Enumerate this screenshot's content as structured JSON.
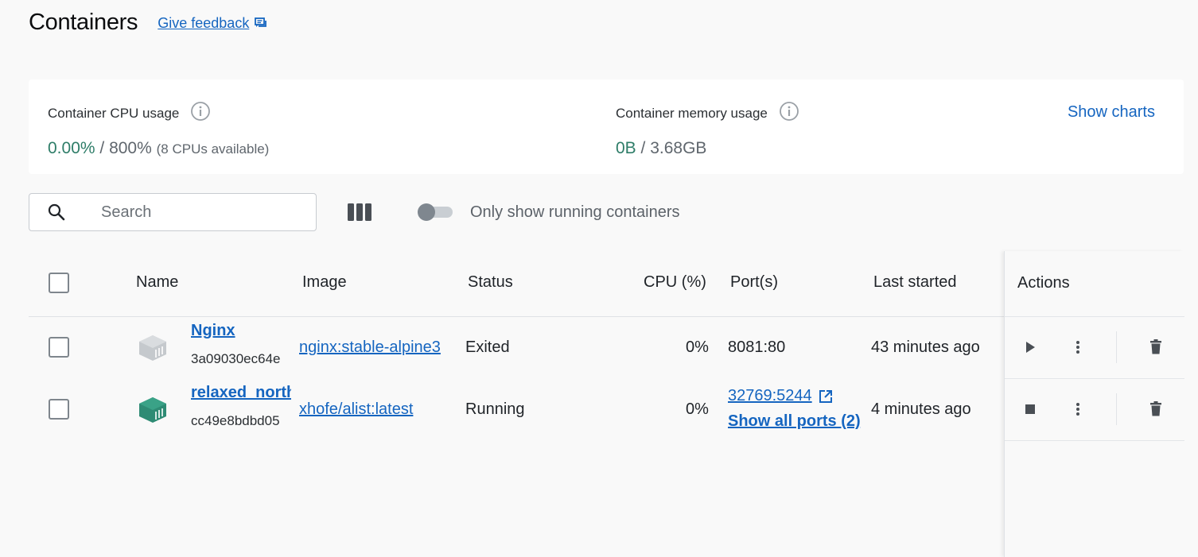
{
  "header": {
    "title": "Containers",
    "feedback_label": "Give feedback"
  },
  "stats": {
    "cpu": {
      "label": "Container CPU usage",
      "used": "0.00%",
      "separator": " / ",
      "total": "800%",
      "note": "(8 CPUs available)"
    },
    "memory": {
      "label": "Container memory usage",
      "used": "0B",
      "separator": " / ",
      "total": "3.68GB"
    },
    "show_charts_label": "Show charts"
  },
  "toolbar": {
    "search_placeholder": "Search",
    "toggle_label": "Only show running containers",
    "toggle_on": false
  },
  "table": {
    "columns": {
      "name": "Name",
      "image": "Image",
      "status": "Status",
      "cpu": "CPU (%)",
      "ports": "Port(s)",
      "last_started": "Last started",
      "actions": "Actions"
    },
    "rows": [
      {
        "name": "Nginx",
        "id": "3a09030ec64e",
        "image": "nginx:stable-alpine3",
        "status": "Exited",
        "cpu": "0%",
        "port": "8081:80",
        "last_started": "43 minutes ago",
        "icon_color": "#c5c9cd",
        "primary_action_icon": "play-icon"
      },
      {
        "name": "relaxed_north",
        "id": "cc49e8bdbd05",
        "image": "xhofe/alist:latest",
        "status": "Running",
        "cpu": "0%",
        "port": "32769:5244",
        "show_all_ports": "Show all ports (2)",
        "last_started": "4 minutes ago",
        "icon_color": "#2e8b74",
        "primary_action_icon": "stop-icon"
      }
    ]
  },
  "colors": {
    "accent_link": "#1565c0",
    "usage_green": "#2e7d68"
  }
}
